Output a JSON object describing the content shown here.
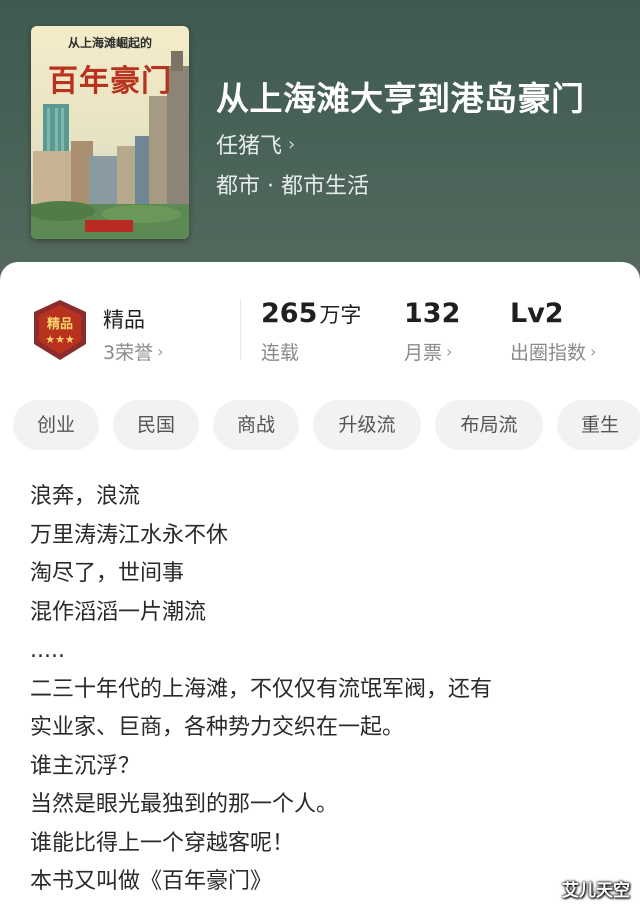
{
  "book": {
    "title": "从上海滩大亨到港岛豪门",
    "author": "任猪飞",
    "genre": "都市 · 都市生活",
    "cover": {
      "subtitle": "从上海滩崛起的",
      "main_title": "百年豪门"
    }
  },
  "stats": {
    "quality": {
      "label": "精品",
      "honors": "3荣誉"
    },
    "words": {
      "value": "265",
      "unit": "万字",
      "status": "连载"
    },
    "tickets": {
      "value": "132",
      "label": "月票"
    },
    "level": {
      "value": "Lv2",
      "label": "出圈指数"
    }
  },
  "tags": [
    "创业",
    "民国",
    "商战",
    "升级流",
    "布局流",
    "重生"
  ],
  "description": [
    "浪奔，浪流",
    "万里涛涛江水永不休",
    "淘尽了，世间事",
    "混作滔滔一片潮流",
    ".....",
    "二三十年代的上海滩，不仅仅有流氓军阀，还有",
    "实业家、巨商，各种势力交织在一起。",
    "谁主沉浮？",
    "当然是眼光最独到的那一个人。",
    "谁能比得上一个穿越客呢！",
    "本书又叫做《百年豪门》"
  ],
  "watermark": "艾儿天空",
  "colors": {
    "header_bg": "#4a6358",
    "tag_bg": "#f2f2f2",
    "badge_red": "#b8321e"
  }
}
